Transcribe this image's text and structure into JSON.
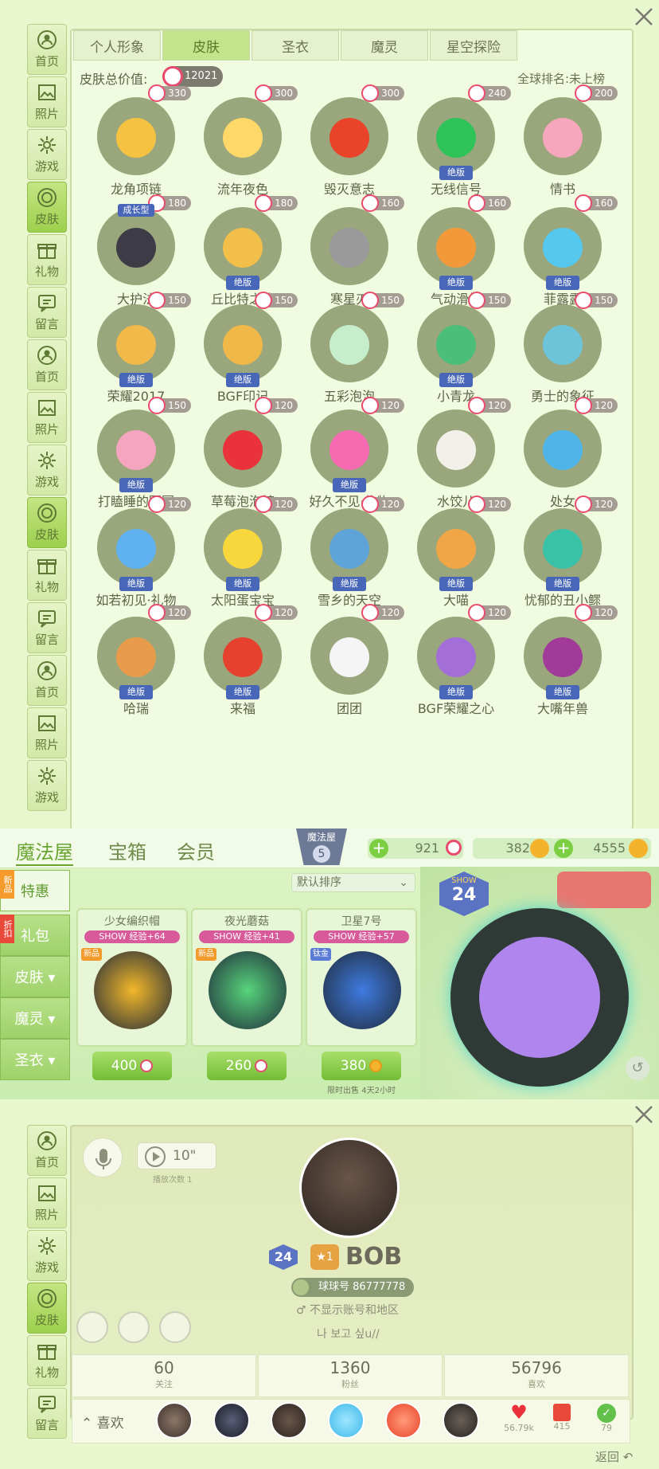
{
  "skin_section": {
    "nav": [
      "首页",
      "照片",
      "游戏",
      "皮肤",
      "礼物",
      "留言"
    ],
    "tabs": [
      "个人形象",
      "皮肤",
      "圣衣",
      "魔灵",
      "星空探险"
    ],
    "total_label": "皮肤总价值:",
    "total_value": "12021",
    "rank_label": "全球排名:未上榜",
    "items": [
      {
        "name": "龙角项链",
        "price": "330",
        "badge": ""
      },
      {
        "name": "流年夜色",
        "price": "300",
        "badge": ""
      },
      {
        "name": "毁灭意志",
        "price": "300",
        "badge": ""
      },
      {
        "name": "无线信号",
        "price": "240",
        "badge": "绝版"
      },
      {
        "name": "情书",
        "price": "200",
        "badge": ""
      },
      {
        "name": "大护法",
        "price": "180",
        "badge": "",
        "top": "成长型"
      },
      {
        "name": "丘比特之箭",
        "price": "180",
        "badge": "绝版"
      },
      {
        "name": "寒星刃",
        "price": "160",
        "badge": ""
      },
      {
        "name": "气动滑板",
        "price": "160",
        "badge": "绝版"
      },
      {
        "name": "菲露露",
        "price": "160",
        "badge": "绝版"
      },
      {
        "name": "荣耀2017",
        "price": "150",
        "badge": "绝版"
      },
      {
        "name": "BGF印记",
        "price": "150",
        "badge": "绝版"
      },
      {
        "name": "五彩泡泡",
        "price": "150",
        "badge": ""
      },
      {
        "name": "小青龙",
        "price": "150",
        "badge": "绝版"
      },
      {
        "name": "勇士的象征",
        "price": "150",
        "badge": ""
      },
      {
        "name": "打瞌睡的圆圆",
        "price": "150",
        "badge": "绝版"
      },
      {
        "name": "草莓泡泡糖",
        "price": "120",
        "badge": ""
      },
      {
        "name": "好久不见·信物",
        "price": "120",
        "badge": "绝版"
      },
      {
        "name": "水饺儿",
        "price": "120",
        "badge": ""
      },
      {
        "name": "处女",
        "price": "120",
        "badge": ""
      },
      {
        "name": "如若初见·礼物",
        "price": "120",
        "badge": "绝版"
      },
      {
        "name": "太阳蛋宝宝",
        "price": "120",
        "badge": "绝版"
      },
      {
        "name": "雪乡的天空",
        "price": "120",
        "badge": "绝版"
      },
      {
        "name": "大喵",
        "price": "120",
        "badge": "绝版"
      },
      {
        "name": "忧郁的丑小鳏",
        "price": "120",
        "badge": "绝版"
      },
      {
        "name": "哈瑞",
        "price": "120",
        "badge": "绝版"
      },
      {
        "name": "来福",
        "price": "120",
        "badge": "绝版"
      },
      {
        "name": "团团",
        "price": "120",
        "badge": ""
      },
      {
        "name": "BGF荣耀之心",
        "price": "120",
        "badge": "绝版"
      },
      {
        "name": "大嘴年兽",
        "price": "120",
        "badge": "绝版"
      }
    ],
    "colors": [
      "#f5c341",
      "#ffd86a",
      "#e9442a",
      "#30c35a",
      "#f6a7bd",
      "#3d3b46",
      "#f2c04a",
      "#9a9a9a",
      "#f29a3a",
      "#56c8ee",
      "#f1b84a",
      "#f0b849",
      "#c7eecb",
      "#4bbf7a",
      "#6dc4d8",
      "#f6a5c1",
      "#e9323a",
      "#f56ab0",
      "#f3f0ea",
      "#4fb5e9",
      "#5fb2ef",
      "#f7d73b",
      "#5ea4d8",
      "#f0a647",
      "#39c2a7",
      "#e89c4b",
      "#e5412e",
      "#f5f5f5",
      "#a46ed9",
      "#a23a99"
    ]
  },
  "shop_section": {
    "tabs": [
      "魔法屋",
      "宝箱",
      "会员"
    ],
    "level_label": "魔法屋",
    "level": "5",
    "currency1": "921",
    "currency2": "382",
    "currency3": "4555",
    "sort_label": "默认排序",
    "side": [
      "特惠",
      "礼包",
      "皮肤 ▾",
      "魔灵 ▾",
      "圣衣 ▾"
    ],
    "side_tags": [
      "新品",
      "折扣"
    ],
    "products": [
      {
        "name": "少女编织帽",
        "exp": "经验+64",
        "tag": "新品",
        "price": "400"
      },
      {
        "name": "夜光蘑菇",
        "exp": "经验+41",
        "tag": "新品",
        "price": "260"
      },
      {
        "name": "卫星7号",
        "exp": "经验+57",
        "tag": "钛金",
        "price": "380",
        "note": "限时出售 4天2小时"
      }
    ],
    "show_label": "SHOW",
    "badge_level": "24"
  },
  "profile_section": {
    "nav": [
      "首页",
      "照片",
      "游戏",
      "皮肤",
      "礼物",
      "留言"
    ],
    "voice_seconds": "10\"",
    "play_count": "播放次数 1",
    "level": "24",
    "star_level": "1",
    "username": "BOB",
    "id_label": "球球号 86777778",
    "region": "♂ 不显示账号和地区",
    "signature": "나 보고 싶u//",
    "stats": [
      {
        "n": "60",
        "l": "关注"
      },
      {
        "n": "1360",
        "l": "粉丝"
      },
      {
        "n": "56796",
        "l": "喜欢"
      }
    ],
    "like_label": "喜欢",
    "counters": [
      {
        "v": "56.79k"
      },
      {
        "v": "415"
      },
      {
        "v": "79"
      }
    ],
    "back_label": "返回"
  }
}
